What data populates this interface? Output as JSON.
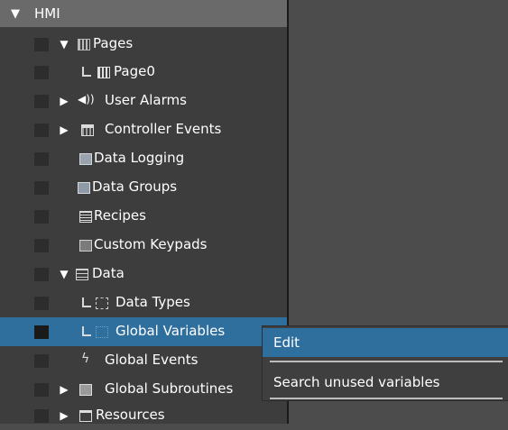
{
  "tree": {
    "root_label": "HMI",
    "items": [
      {
        "label": "Pages"
      },
      {
        "label": "Page0"
      },
      {
        "label": "User Alarms"
      },
      {
        "label": "Controller Events"
      },
      {
        "label": "Data Logging"
      },
      {
        "label": "Data Groups"
      },
      {
        "label": "Recipes"
      },
      {
        "label": "Custom Keypads"
      },
      {
        "label": "Data"
      },
      {
        "label": "Data Types"
      },
      {
        "label": "Global Variables"
      },
      {
        "label": "Global Events"
      },
      {
        "label": "Global Subroutines"
      },
      {
        "label": "Resources"
      }
    ]
  },
  "context_menu": {
    "items": [
      {
        "label": "Edit"
      },
      {
        "label": "Search unused variables"
      }
    ]
  },
  "icons": {
    "expanded": "triangle-down-icon",
    "collapsed": "triangle-right-icon"
  },
  "colors": {
    "selection": "#2f6f9e",
    "panel": "#3d3d3d",
    "background": "#4c4c4c",
    "header": "#6a6a6a"
  }
}
